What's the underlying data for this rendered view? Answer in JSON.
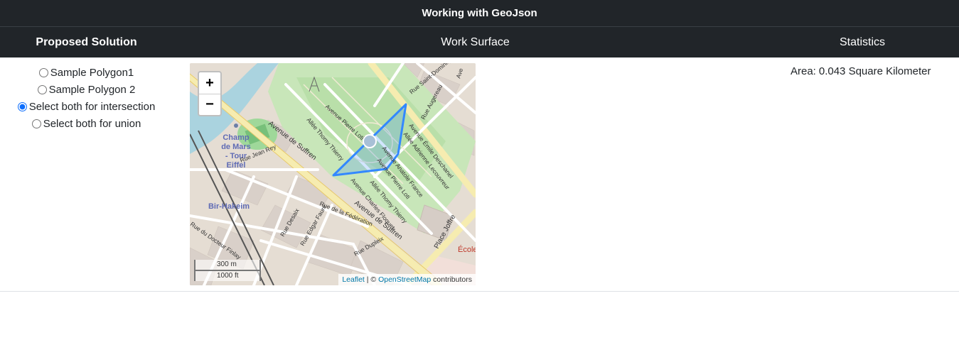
{
  "app": {
    "title": "Working with GeoJson"
  },
  "columns": {
    "left": "Proposed Solution",
    "middle": "Work Surface",
    "right": "Statistics"
  },
  "options": [
    {
      "label": "Sample Polygon1",
      "checked": false
    },
    {
      "label": "Sample Polygon 2",
      "checked": false
    },
    {
      "label": "Select both for intersection",
      "checked": true
    },
    {
      "label": "Select both for union",
      "checked": false
    }
  ],
  "map": {
    "zoom_in": "+",
    "zoom_out": "−",
    "scale_metric": "300 m",
    "scale_imperial": "1000 ft",
    "attribution_leaflet": "Leaflet",
    "attribution_sep": " | © ",
    "attribution_osm": "OpenStreetMap",
    "attribution_suffix": " contributors",
    "place_labels": {
      "champ": "Champ",
      "de_mars": "de Mars",
      "tour": "- Tour",
      "eiffel": "Eiffel",
      "bir_hakeim": "Bir-Hakeim",
      "ecole": "École"
    },
    "street_labels": {
      "suffren_1": "Avenue de Suffren",
      "suffren_2": "Avenue de Suffren",
      "pierre_loti": "Avenue Pierre Loti",
      "thomy_thierry": "Allée Thomy Thierry",
      "anatole_france": "Avenue Anatole France",
      "lecouvreur": "Allée Adrienne Lecouvreur",
      "deschanel": "Avenue Émile Deschanel",
      "saint_dominique": "Rue Saint-Dominique",
      "augereau": "Rue Augereau",
      "jean_rey": "Rue Jean Rey",
      "federation": "Rue de la Fédération",
      "desaix": "Rue Desaix",
      "edgar_faure": "Rue Edgar Faure",
      "docteur_finlay": "Rue du Docteur Finlay",
      "dupleix": "Rue Dupleix",
      "charles_floquet": "Avenue Charles Floquet",
      "pierre_loti_2": "Avenue Pierre Loti",
      "thomy_thierry_2": "Allée Thomy Thierry",
      "place_joffre": "Place Joffre",
      "ave": "Ave"
    }
  },
  "stats": {
    "area_label": "Area:",
    "area_value": "0.043 Square Kilometer"
  },
  "colors": {
    "header_bg": "#212529",
    "polygon": "#3388ff",
    "radio": "#0d6efd"
  }
}
